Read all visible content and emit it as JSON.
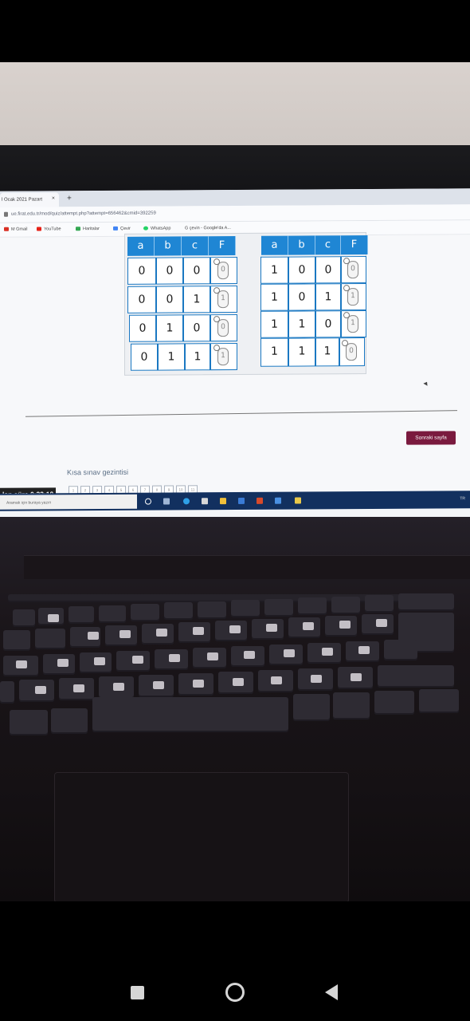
{
  "browser": {
    "tab_title": "l Ocak 2021 Pazart",
    "tab_close": "×",
    "new_tab": "+",
    "url": "ue.firat.edu.tr/mod/quiz/attempt.php?attempt=656462&cmid=392259",
    "bookmarks": [
      {
        "label": "M  Gmail",
        "color": "#d93025"
      },
      {
        "label": "YouTube",
        "color": "#e62117"
      },
      {
        "label": "Haritalar",
        "color": "#34a853"
      },
      {
        "label": "Çevir",
        "color": "#4285f4"
      },
      {
        "label": "WhatsApp",
        "color": "#25d366"
      },
      {
        "label": "G  çevin - Google'da A...",
        "color": "#4285f4"
      }
    ]
  },
  "truth_table_left": {
    "headers": [
      "a",
      "b",
      "c",
      "F"
    ],
    "rows": [
      [
        "0",
        "0",
        "0",
        "0"
      ],
      [
        "0",
        "0",
        "1",
        "1"
      ],
      [
        "0",
        "1",
        "0",
        "0"
      ],
      [
        "0",
        "1",
        "1",
        "1"
      ]
    ]
  },
  "truth_table_right": {
    "headers": [
      "a",
      "b",
      "c",
      "F"
    ],
    "rows": [
      [
        "1",
        "0",
        "0",
        "0"
      ],
      [
        "1",
        "0",
        "1",
        "1"
      ],
      [
        "1",
        "1",
        "0",
        "1"
      ],
      [
        "1",
        "1",
        "1",
        "0"
      ]
    ]
  },
  "quiz": {
    "next_page_label": "Sonraki sayfa",
    "navigation_title": "Kısa sınav gezintisi",
    "timer_label": "lan süre 0:33:10",
    "question_numbers": [
      "1",
      "2",
      "3",
      "4",
      "5",
      "6",
      "7",
      "8",
      "9",
      "10",
      "11"
    ]
  },
  "taskbar": {
    "search_placeholder": "Aramak için buraya yazın",
    "tray_text": "TR"
  },
  "colors": {
    "table_header": "#1f86d4",
    "table_border": "#1a78c2",
    "next_button": "#7a1a3e",
    "taskbar": "#12305f"
  }
}
